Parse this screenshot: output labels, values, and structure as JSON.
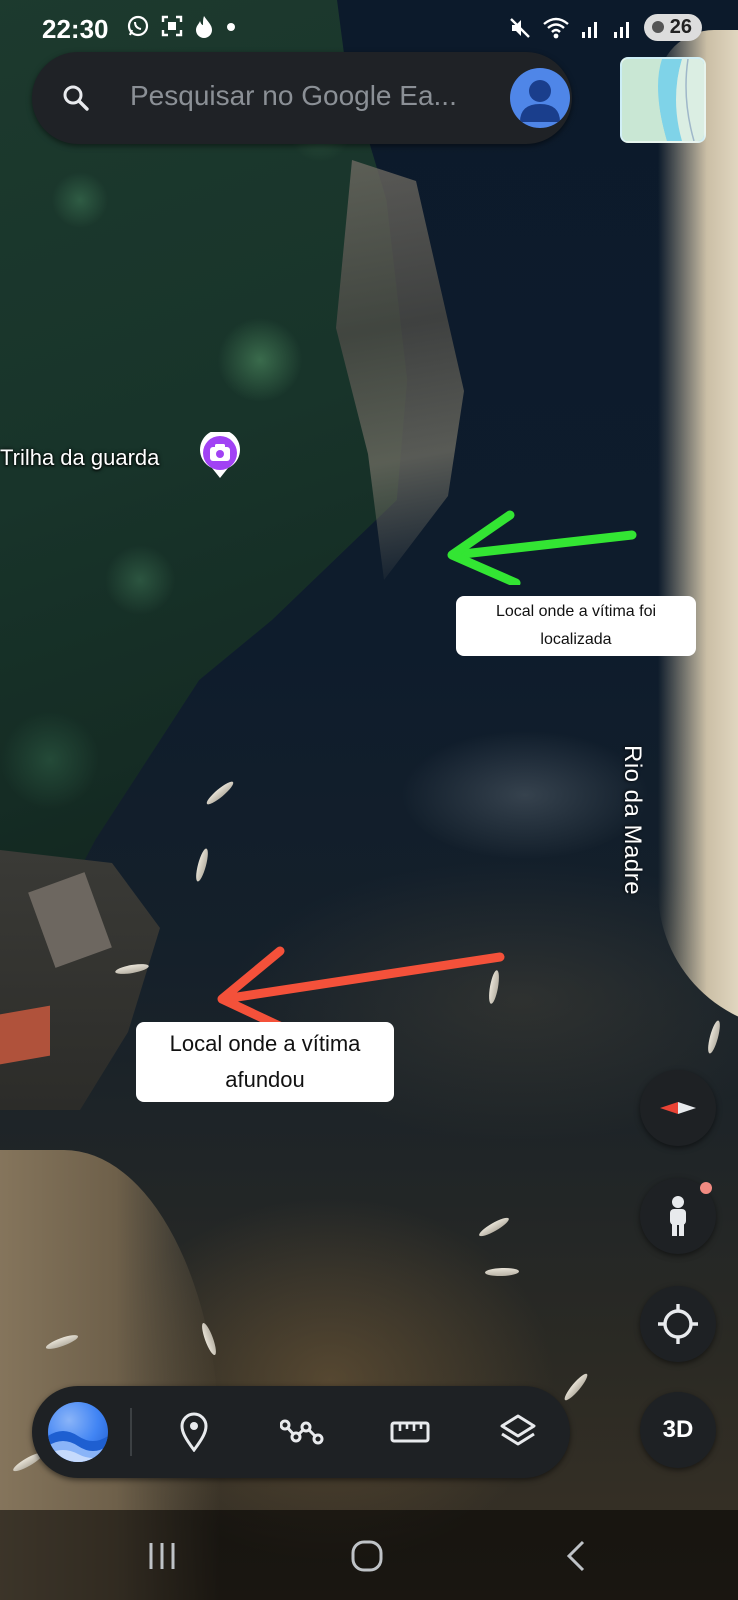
{
  "status_bar": {
    "time": "22:30",
    "left_icons": [
      "whatsapp-icon",
      "screenshot-icon",
      "flame-icon",
      "dot-icon"
    ],
    "right_icons": [
      "mute-icon",
      "wifi-icon",
      "signal-icon",
      "signal-icon"
    ],
    "battery": "26"
  },
  "search": {
    "placeholder": "Pesquisar no Google Ea..."
  },
  "map": {
    "place_label": "Trilha da guarda",
    "river_label": "Rio da Madre",
    "annotations": [
      {
        "text": "Local onde a vítima foi localizada",
        "arrow_color": "#33e533"
      },
      {
        "text": "Local onde a vítima afundou",
        "arrow_color": "#f4513a"
      }
    ]
  },
  "side_buttons": {
    "threed_label": "3D"
  },
  "colors": {
    "panel": "#1e2124",
    "accent_blue": "#4285f4",
    "pin_purple": "#a142f4",
    "compass_red": "#ea4335"
  }
}
